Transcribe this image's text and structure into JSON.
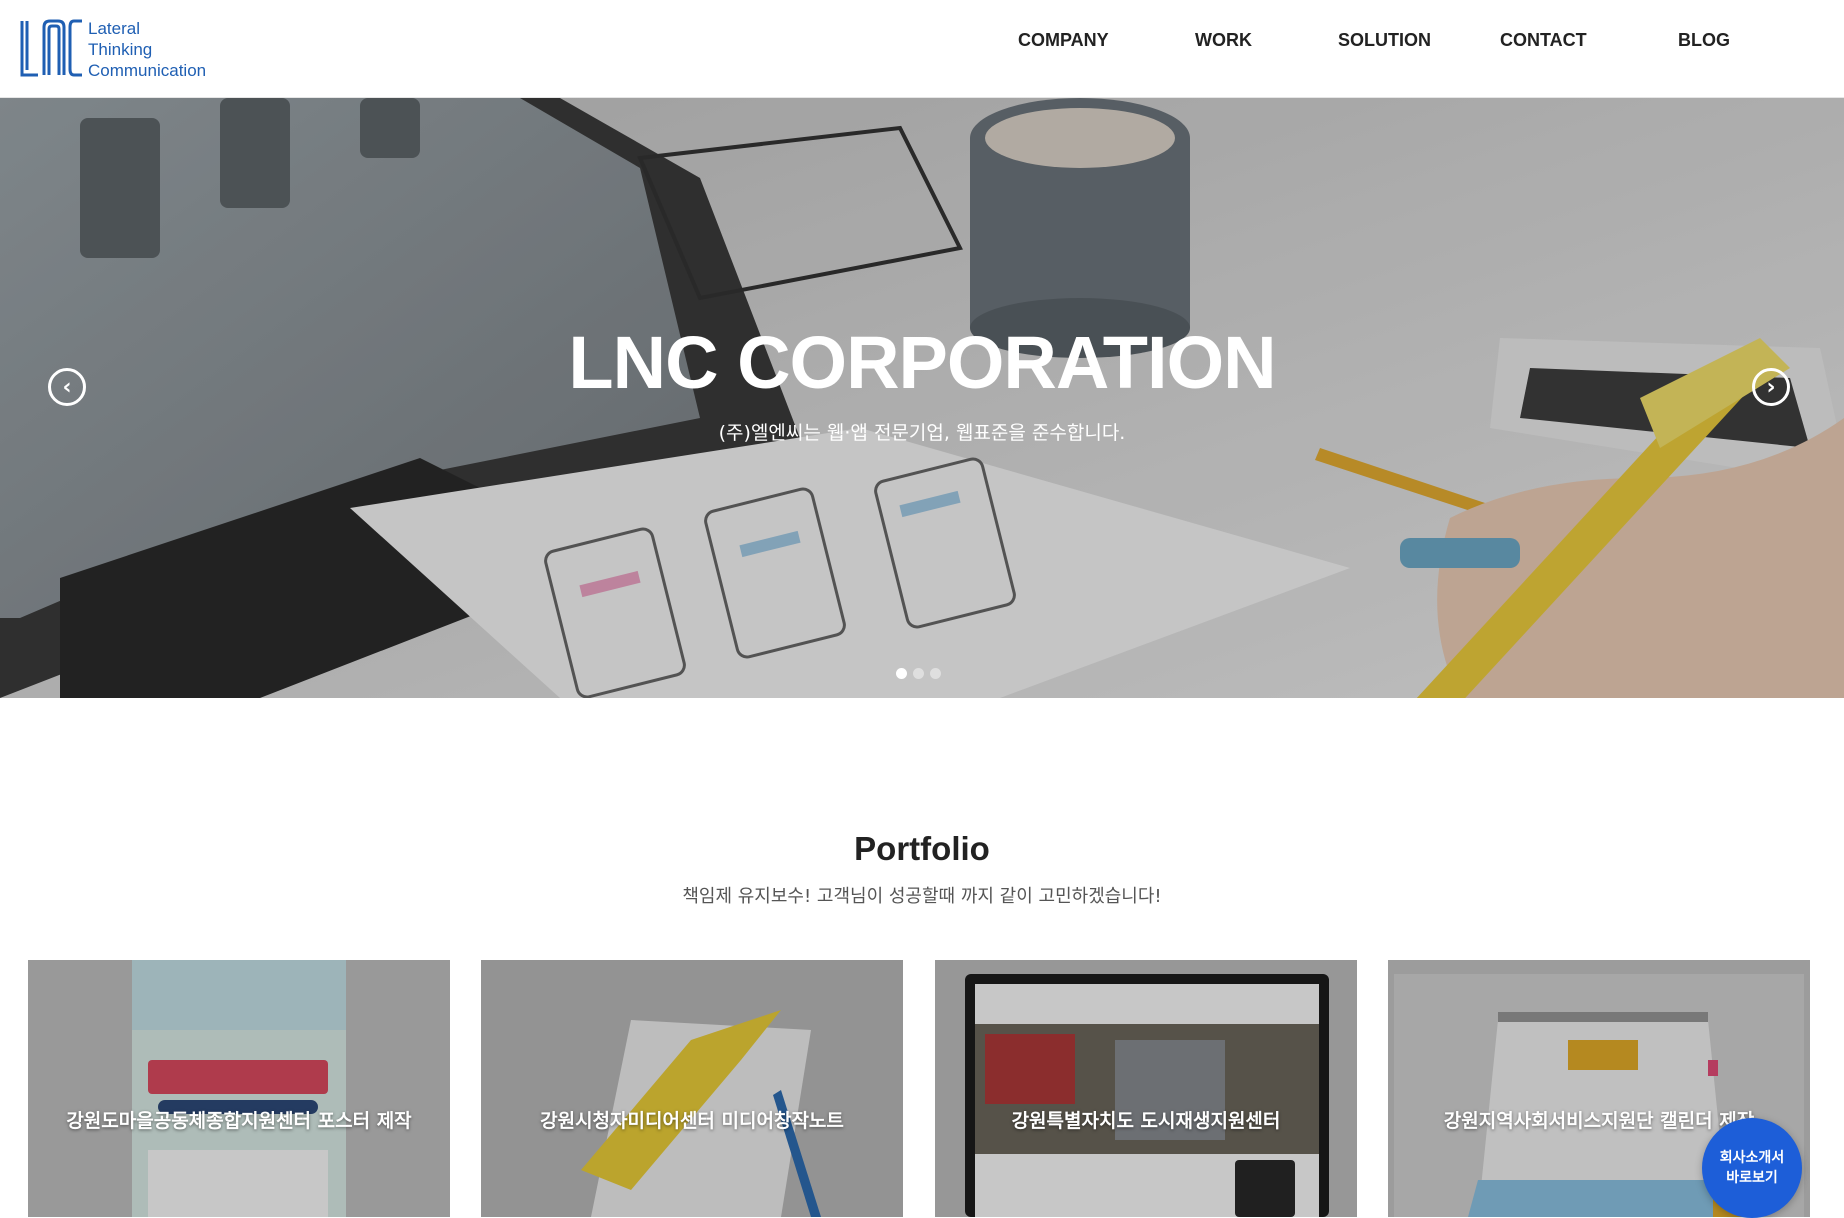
{
  "brand": {
    "logo_lines": [
      "Lateral",
      "Thinking",
      "Communication"
    ],
    "color": "#1f5fb3"
  },
  "nav": {
    "items": [
      {
        "label": "COMPANY"
      },
      {
        "label": "WORK"
      },
      {
        "label": "SOLUTION"
      },
      {
        "label": "CONTACT"
      },
      {
        "label": "BLOG"
      }
    ]
  },
  "hero": {
    "title": "LNC CORPORATION",
    "subtitle": "(주)엘엔씨는 웹·앱 전문기업, 웹표준을 준수합니다.",
    "prev_icon": "chevron-left-icon",
    "next_icon": "chevron-right-icon",
    "slides_total": 3,
    "active_slide": 1
  },
  "portfolio": {
    "title": "Portfolio",
    "subtitle": "책임제 유지보수! 고객님이 성공할때 까지 같이 고민하겠습니다!",
    "items": [
      {
        "label": "강원도마을공동체종합지원센터 포스터 제작"
      },
      {
        "label": "강원시청자미디어센터 미디어창작노트"
      },
      {
        "label": "강원특별자치도 도시재생지원센터"
      },
      {
        "label": "강원지역사회서비스지원단 캘린더 제작"
      }
    ]
  },
  "fab": {
    "line1": "회사소개서",
    "line2": "바로보기",
    "color": "#1d5ed8"
  }
}
